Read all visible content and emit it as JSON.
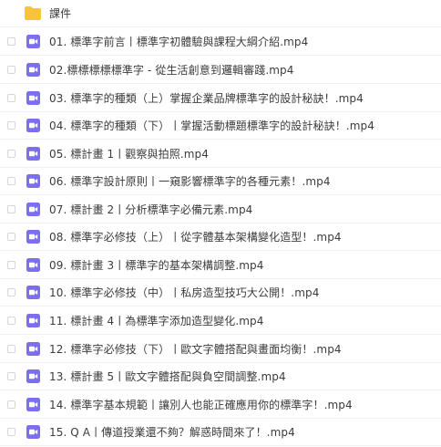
{
  "folder": {
    "name": "課件",
    "icon": "folder-icon",
    "icon_color": "#f9c33a"
  },
  "video_icon": {
    "name": "video-file-icon",
    "color": "#7b6ff0"
  },
  "files": [
    {
      "name": "01. 標準字前言丨標準字初體驗與課程大綱介紹.mp4"
    },
    {
      "name": "02.標標標標標準字 - 從生活創意到邏輯審踐.mp4"
    },
    {
      "name": "03. 標準字的種類（上）掌握企業品牌標準字的設計秘訣！.mp4"
    },
    {
      "name": "04. 標準字的種類（下）丨掌握活動標題標準字的設計秘訣！.mp4"
    },
    {
      "name": "05. 標計畫 1丨觀察與拍照.mp4"
    },
    {
      "name": "06. 標準字設計原則丨一窺影響標準字的各種元素！.mp4"
    },
    {
      "name": "07. 標計畫 2丨分析標準字必備元素.mp4"
    },
    {
      "name": "08. 標準字必修技（上）丨從字體基本架構變化造型！.mp4"
    },
    {
      "name": "09. 標計畫 3丨標準字的基本架構調整.mp4"
    },
    {
      "name": "10. 標準字必修技（中）丨私房造型技巧大公開！.mp4"
    },
    {
      "name": "11. 標計畫 4丨為標準字添加造型變化.mp4"
    },
    {
      "name": "12. 標準字必修技（下）丨歐文字體搭配與畫面均衡！.mp4"
    },
    {
      "name": "13. 標計畫 5丨歐文字體搭配與負空間調整.mp4"
    },
    {
      "name": "14. 標準字基本規範丨讓別人也能正確應用你的標準字！.mp4"
    },
    {
      "name": "15. Q A丨傳道授業還不夠？解惑時間來了！.mp4"
    }
  ]
}
